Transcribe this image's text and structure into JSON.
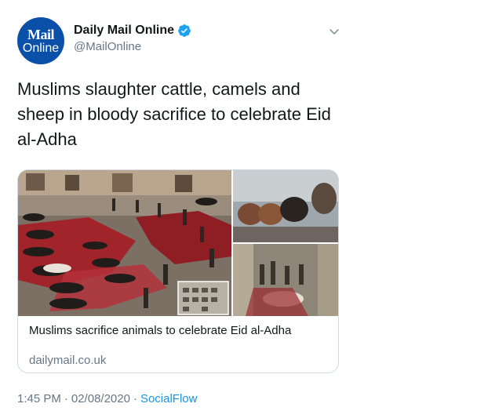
{
  "account": {
    "avatar_line1": "Mail",
    "avatar_line2": "Online",
    "display_name": "Daily Mail Online",
    "handle": "@MailOnline",
    "verified": true
  },
  "tweet": {
    "text": "Muslims slaughter cattle, camels and sheep in bloody sacrifice to celebrate Eid al-Adha"
  },
  "card": {
    "title": "Muslims sacrifice animals to celebrate Eid al-Adha",
    "domain": "dailymail.co.uk"
  },
  "meta": {
    "time": "1:45 PM",
    "separator": "·",
    "date": "02/08/2020",
    "source": "SocialFlow"
  },
  "colors": {
    "brand_blue": "#0a4fa8",
    "link_blue": "#1b95e0",
    "muted": "#657786"
  },
  "icons": [
    "verified-badge-icon",
    "chevron-down-icon"
  ]
}
